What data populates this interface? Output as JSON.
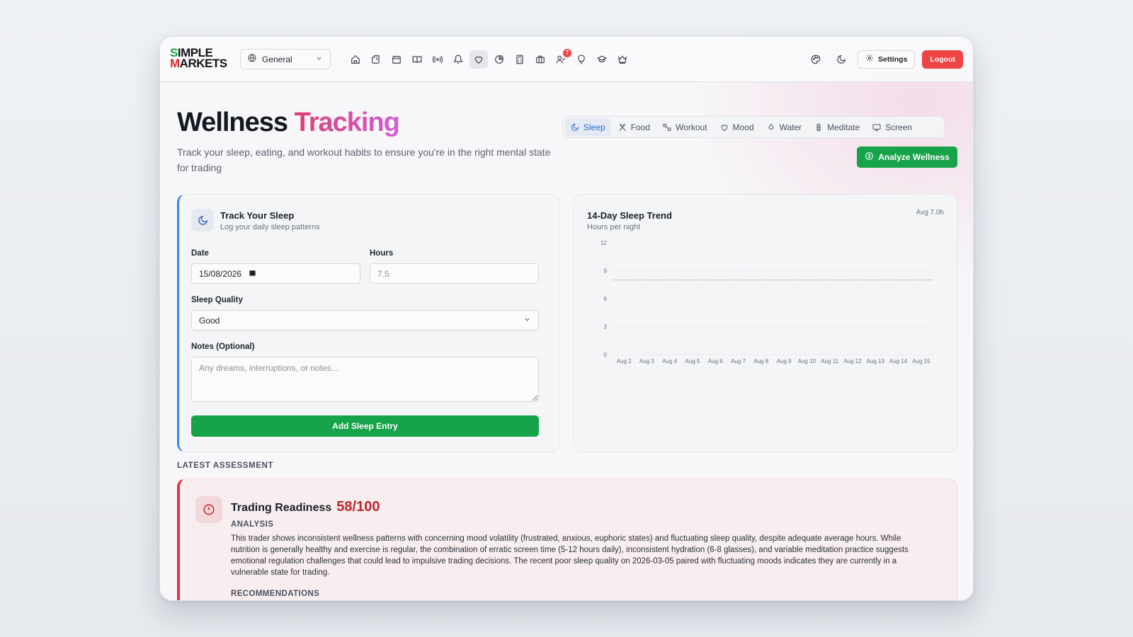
{
  "nav": {
    "logo_line1_s": "S",
    "logo_line1_rest": "IMPLE",
    "logo_line2_m": "M",
    "logo_line2_rest": "ARKETS",
    "workspace": "General",
    "notification_count": "7",
    "settings_label": "Settings",
    "logout_label": "Logout"
  },
  "header": {
    "title_plain": "Wellness",
    "title_accent": "Tracking",
    "subtitle": "Track your sleep, eating, and workout habits to ensure you're in the right mental state for trading",
    "analyze_label": "Analyze Wellness"
  },
  "tabs": [
    {
      "label": "Sleep",
      "icon": "moon-icon"
    },
    {
      "label": "Food",
      "icon": "utensils-icon"
    },
    {
      "label": "Workout",
      "icon": "dumbbell-icon"
    },
    {
      "label": "Mood",
      "icon": "heart-icon"
    },
    {
      "label": "Water",
      "icon": "droplet-icon"
    },
    {
      "label": "Meditate",
      "icon": "meditate-icon"
    },
    {
      "label": "Screen",
      "icon": "monitor-icon"
    }
  ],
  "sleep_form": {
    "title": "Track Your Sleep",
    "subtitle": "Log your daily sleep patterns",
    "date_label": "Date",
    "date_value": "15/08/2026",
    "hours_label": "Hours",
    "hours_placeholder": "7.5",
    "quality_label": "Sleep Quality",
    "quality_value": "Good",
    "notes_label": "Notes (Optional)",
    "notes_placeholder": "Any dreams, interruptions, or notes...",
    "submit_label": "Add Sleep Entry"
  },
  "trend": {
    "title": "14-Day Sleep Trend",
    "subtitle": "Hours per night",
    "avg_label": "Avg 7.0h"
  },
  "chart_data": {
    "type": "bar",
    "title": "14-Day Sleep Trend",
    "subtitle": "Hours per night",
    "categories": [
      "Aug 2",
      "Aug 3",
      "Aug 4",
      "Aug 5",
      "Aug 6",
      "Aug 7",
      "Aug 8",
      "Aug 9",
      "Aug 10",
      "Aug 11",
      "Aug 12",
      "Aug 13",
      "Aug 14",
      "Aug 15"
    ],
    "values": [
      0,
      0,
      0,
      0,
      0,
      0,
      0,
      0,
      0,
      0,
      0,
      0,
      0,
      0
    ],
    "yticks": [
      0,
      3,
      6,
      9,
      12
    ],
    "ylim": [
      0,
      12
    ],
    "target_line": 8,
    "grid": true,
    "xlabel": "",
    "ylabel": ""
  },
  "assessment": {
    "section_label": "LATEST ASSESSMENT",
    "title": "Trading Readiness",
    "score": "58/100",
    "analysis_heading": "ANALYSIS",
    "analysis_text": "This trader shows inconsistent wellness patterns with concerning mood volatility (frustrated, anxious, euphoric states) and fluctuating sleep quality, despite adequate average hours. While nutrition is generally healthy and exercise is regular, the combination of erratic screen time (5-12 hours daily), inconsistent hydration (6-8 glasses), and variable meditation practice suggests emotional regulation challenges that could lead to impulsive trading decisions. The recent poor sleep quality on 2026-03-05 paired with fluctuating moods indicates they are currently in a vulnerable state for trading.",
    "recommendations_heading": "RECOMMENDATIONS"
  },
  "colors": {
    "accent_green": "#16a34a",
    "accent_red": "#ef4444",
    "accent_blue": "#3b82f6",
    "score_red": "#c0262d"
  }
}
